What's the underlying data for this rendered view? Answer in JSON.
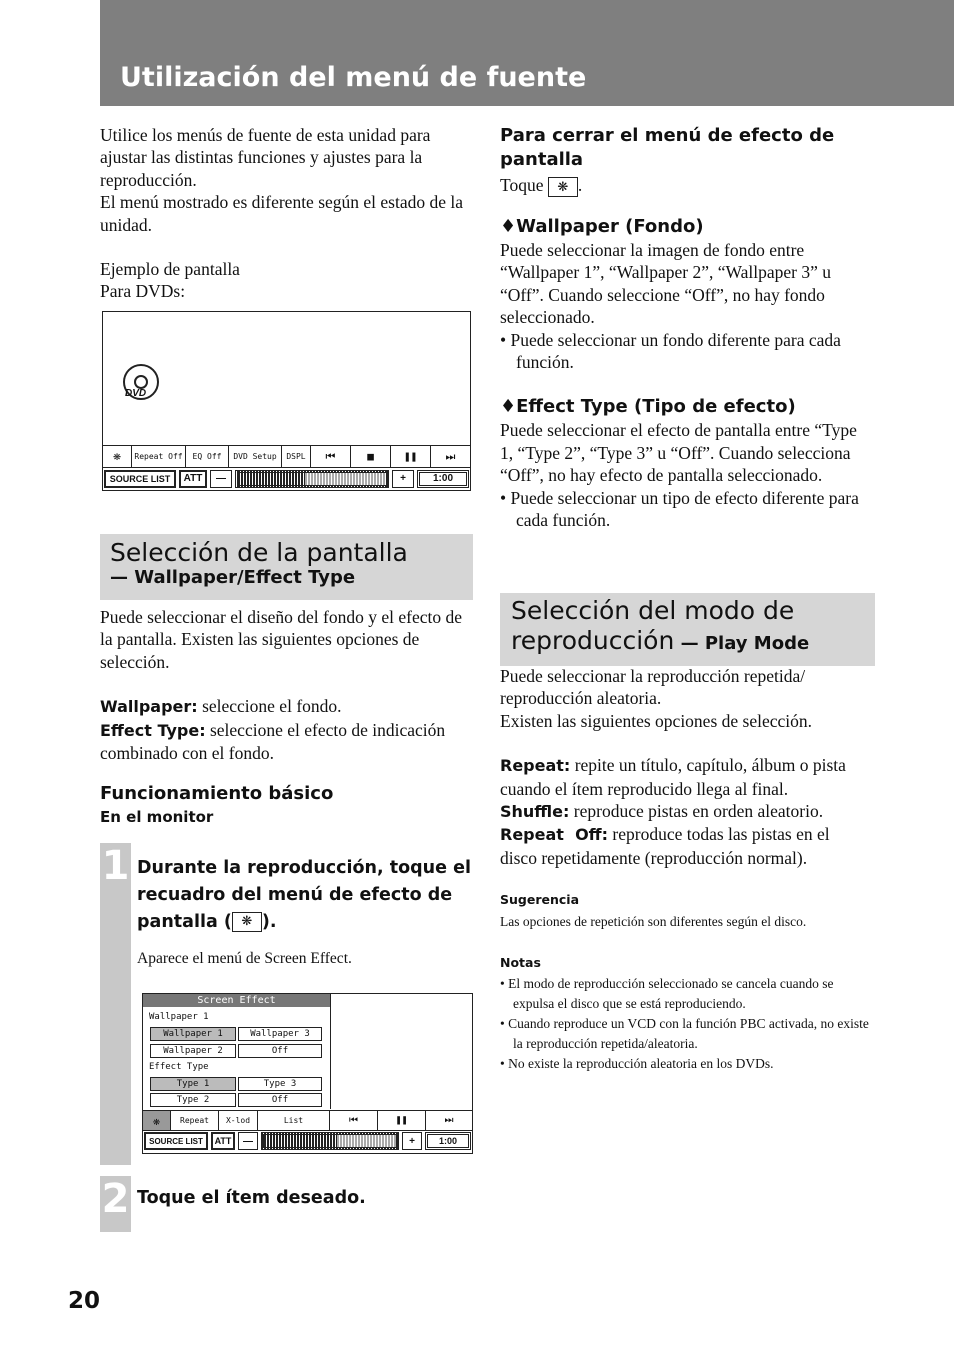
{
  "header": {
    "title": "Utilización del menú de fuente"
  },
  "intro": {
    "p1": "Utilice los menús de fuente de esta unidad para ajustar las distintas funciones y ajustes para la reproducción.",
    "p2": "El menú mostrado es diferente según el estado de la unidad.",
    "example": "Ejemplo de pantalla",
    "for_dvds": "Para DVDs:"
  },
  "dvd_screen": {
    "logo": "DVD",
    "bar": [
      "Repeat Off",
      "EQ Off",
      "DVD Setup",
      "DSPL"
    ],
    "icons": [
      "screen-effect-icon",
      "prev-icon",
      "stop-icon",
      "pause-icon",
      "next-icon"
    ],
    "source_list": "SOURCE LIST",
    "att": "ATT",
    "minus": "—",
    "plus": "+",
    "time": "1:00",
    "volume_level": 0.45
  },
  "sec1": {
    "title": "Selección de la pantalla",
    "subtitle": "— Wallpaper/Effect Type",
    "p1": "Puede seleccionar el diseño del fondo y el efecto de la pantalla. Existen las siguientes opciones de selección.",
    "wallpaper_label": "Wallpaper:",
    "wallpaper_text": " seleccione el fondo.",
    "effect_label": "Effect Type:",
    "effect_text": " seleccione el efecto de indicación combinado con el fondo.",
    "basic": "Funcionamiento básico",
    "monitor": "En el monitor"
  },
  "steps": [
    {
      "num": "1",
      "text_a": "Durante la reproducción, toque el recuadro del menú de efecto de pantalla (",
      "text_b": ").",
      "sub": "Aparece el menú de Screen Effect."
    },
    {
      "num": "2",
      "text_a": "Toque el ítem deseado."
    }
  ],
  "effect_screen": {
    "title": "Screen Effect",
    "wallpaper_heading": "Wallpaper 1",
    "wallpapers": [
      "Wallpaper 1",
      "Wallpaper 3",
      "Wallpaper 2",
      "Off"
    ],
    "effect_heading": "Effect Type",
    "types": [
      "Type 1",
      "Type 3",
      "Type 2",
      "Off"
    ],
    "bar": [
      "Repeat",
      "X-lod",
      "List"
    ],
    "source_list": "SOURCE LIST",
    "att": "ATT",
    "minus": "—",
    "plus": "+",
    "time": "1:00"
  },
  "right": {
    "close_title": "Para cerrar el menú de efecto de pantalla",
    "touch": "Toque",
    "wallpaper_title": "Wallpaper (Fondo)",
    "wallpaper_p": "Puede seleccionar la imagen de fondo entre “Wallpaper 1”, “Wallpaper 2”, “Wallpaper 3” u “Off”. Cuando seleccione “Off”, no hay fondo seleccionado.",
    "wallpaper_bullet": "Puede seleccionar un fondo diferente para cada función.",
    "effect_title": "Effect Type (Tipo de efecto)",
    "effect_p": "Puede seleccionar el efecto de pantalla entre “Type 1, “Type 2”, “Type 3” u “Off”. Cuando selecciona “Off”, no hay efecto de pantalla seleccionado.",
    "effect_bullet": "Puede seleccionar un tipo de efecto diferente para cada función."
  },
  "sec2": {
    "title_a": "Selección del modo de",
    "title_b": "reproducción",
    "subtitle": " — Play Mode",
    "p1": "Puede seleccionar la reproducción repetida/ reproducción aleatoria.",
    "p2": "Existen las siguientes opciones de selección.",
    "repeat_label": "Repeat:",
    "repeat_text": " repite un título, capítulo, álbum o pista cuando el ítem reproducido llega al final.",
    "shuffle_label": "Shuffle:",
    "shuffle_text": " reproduce pistas en orden aleatorio.",
    "off_label": "Repeat  Off:",
    "off_text": " reproduce todas las pistas en el disco repetidamente (reproducción normal).",
    "tip_title": "Sugerencia",
    "tip": "Las opciones de repetición son diferentes según el disco.",
    "notes_title": "Notas",
    "notes": [
      "El modo de reproducción seleccionado se cancela cuando se expulsa el disco que se está reproduciendo.",
      "Cuando reproduce un VCD con la función PBC activada, no existe la reproducción repetida/aleatoria.",
      "No existe la reproducción aleatoria en los DVDs."
    ]
  },
  "page_number": "20"
}
